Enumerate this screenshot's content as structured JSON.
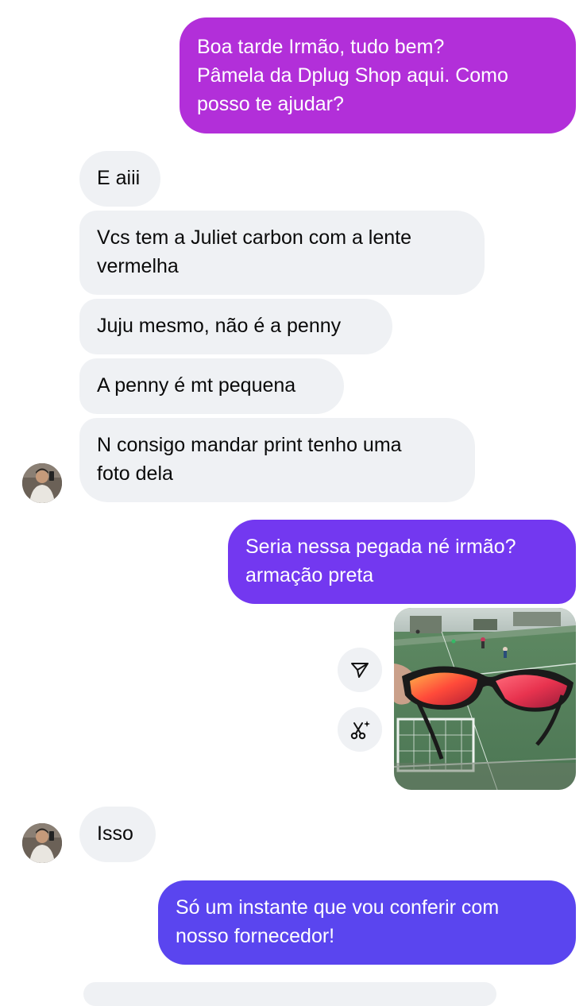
{
  "thread": {
    "messages": [
      {
        "id": "m1",
        "direction": "outgoing",
        "lines": [
          "Boa tarde Irmão, tudo bem?",
          "Pâmela da Dplug Shop aqui. Como",
          "posso te ajudar?"
        ],
        "color": "#b22fd9"
      },
      {
        "id": "m2",
        "direction": "incoming",
        "lines": [
          "E aiii"
        ]
      },
      {
        "id": "m3",
        "direction": "incoming",
        "lines": [
          "Vcs tem a Juliet carbon com a lente",
          "vermelha"
        ]
      },
      {
        "id": "m4",
        "direction": "incoming",
        "lines": [
          "Juju mesmo, não é a penny"
        ]
      },
      {
        "id": "m5",
        "direction": "incoming",
        "lines": [
          "A penny é mt pequena"
        ]
      },
      {
        "id": "m6",
        "direction": "incoming",
        "lines": [
          "N consigo mandar print tenho uma",
          "foto dela"
        ]
      },
      {
        "id": "m7",
        "direction": "outgoing",
        "lines": [
          "Seria nessa pegada né irmão?",
          "armação preta"
        ],
        "color": "#7338f0"
      },
      {
        "id": "m8",
        "direction": "outgoing",
        "type": "photo",
        "icon": "sunglasses-photo"
      },
      {
        "id": "m9",
        "direction": "incoming",
        "lines": [
          "Isso"
        ]
      },
      {
        "id": "m10",
        "direction": "outgoing",
        "lines": [
          "Só um instante que vou conferir com",
          "nosso fornecedor!"
        ],
        "color": "#5a45ef"
      }
    ],
    "photo_actions": [
      {
        "icon": "share-icon"
      },
      {
        "icon": "ai-edit-icon"
      }
    ]
  }
}
